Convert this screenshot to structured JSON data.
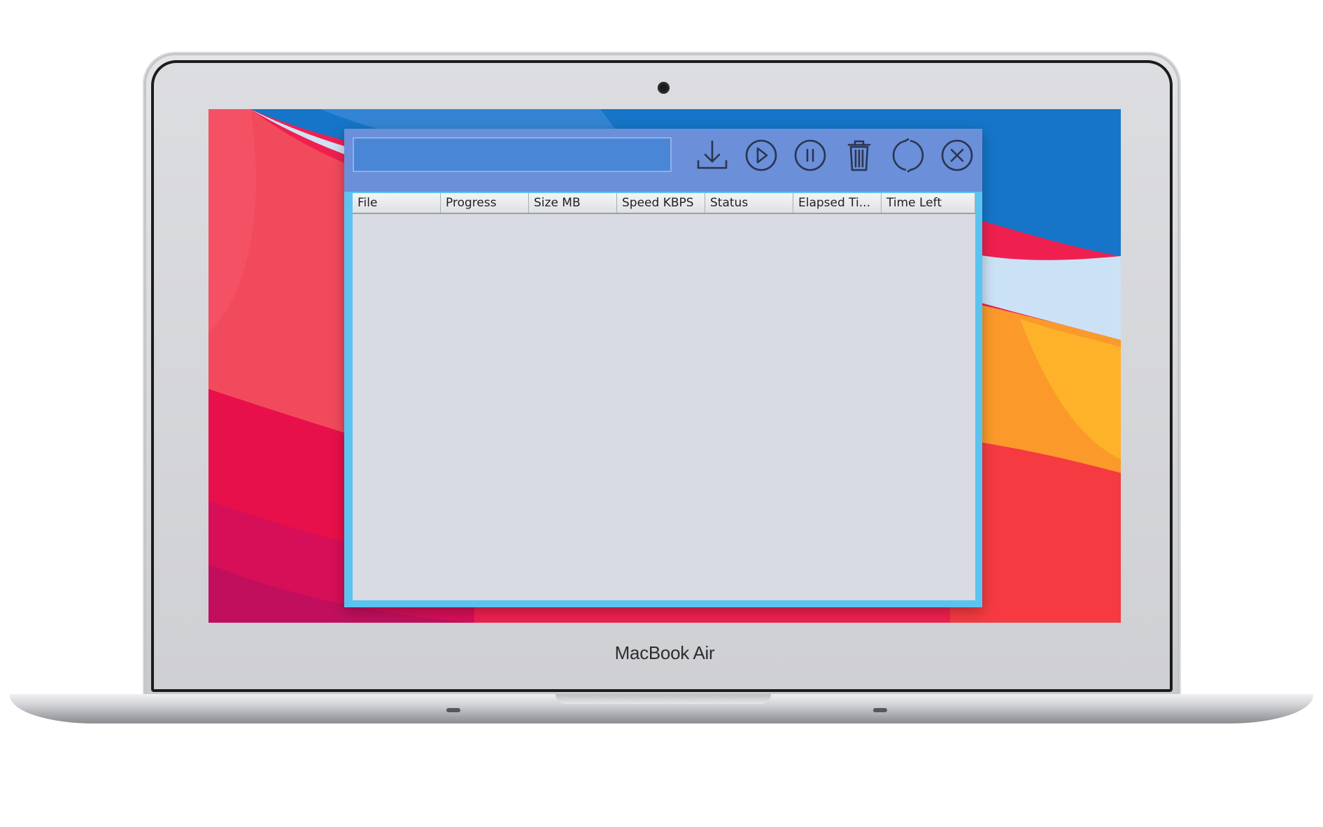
{
  "device": {
    "brand_label": "MacBook Air"
  },
  "app": {
    "url_input": {
      "value": "",
      "placeholder": ""
    },
    "toolbar": [
      {
        "name": "download-icon",
        "label": "Download"
      },
      {
        "name": "play-icon",
        "label": "Resume"
      },
      {
        "name": "pause-icon",
        "label": "Pause"
      },
      {
        "name": "trash-icon",
        "label": "Delete"
      },
      {
        "name": "refresh-icon",
        "label": "Restart"
      },
      {
        "name": "close-icon",
        "label": "Cancel"
      }
    ],
    "table": {
      "columns": [
        "File",
        "Progress",
        "Size MB",
        "Speed KBPS",
        "Status",
        "Elapsed Ti...",
        "Time Left"
      ],
      "rows": []
    }
  },
  "colors": {
    "window_frame": "#5bc3f0",
    "toolbar_bg": "#6b8fd9",
    "input_bg": "#4a86d6",
    "table_bg": "#d8dbe3",
    "icon_stroke": "#2a3550"
  }
}
